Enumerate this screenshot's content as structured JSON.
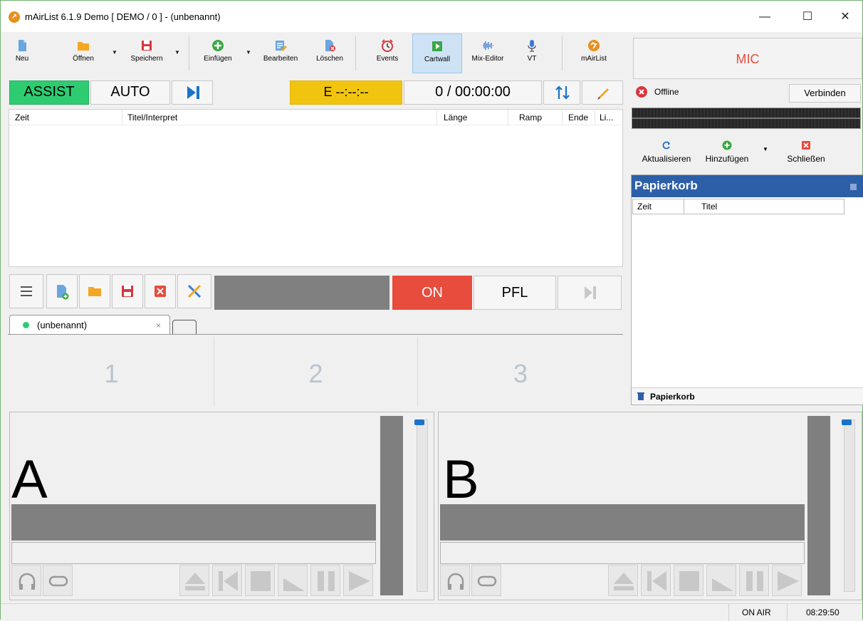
{
  "window": {
    "title": "mAirList 6.1.9 Demo [ DEMO / 0 ] - (unbenannt)",
    "app_icon": "mairlist-logo-icon"
  },
  "toolbar": {
    "neu": "Neu",
    "oeffnen": "Öffnen",
    "speichern": "Speichern",
    "einfuegen": "Einfügen",
    "bearbeiten": "Bearbeiten",
    "loeschen": "Löschen",
    "events": "Events",
    "cartwall": "Cartwall",
    "mix_editor": "Mix-Editor",
    "vt": "VT",
    "mairlist": "mAirList"
  },
  "mode": {
    "assist": "ASSIST",
    "auto": "AUTO",
    "end_time": "E  --:--:--",
    "counter": "0 / 00:00:00"
  },
  "playlist": {
    "columns": [
      "Zeit",
      "Titel/Interpret",
      "Länge",
      "Ramp",
      "Ende",
      "Li..."
    ]
  },
  "controls": {
    "on": "ON",
    "pfl": "PFL"
  },
  "cartwall": {
    "tab_label": "(unbenannt)",
    "tab_close": "×",
    "cells": [
      "1",
      "2",
      "3"
    ]
  },
  "players": {
    "a": "A",
    "b": "B"
  },
  "encoder": {
    "mic": "MIC",
    "status": "Offline",
    "connect": "Verbinden",
    "refresh": "Aktualisieren",
    "add": "Hinzufügen",
    "close": "Schließen"
  },
  "papierkorb": {
    "title": "Papierkorb",
    "columns": [
      "Zeit",
      "Titel"
    ],
    "footer": "Papierkorb"
  },
  "status": {
    "on_air": "ON AIR",
    "clock": "08:29:50"
  },
  "colors": {
    "assist_green": "#2ecc71",
    "end_yellow": "#f1c40f",
    "on_red": "#e74c3c",
    "mic_red": "#e74c3c",
    "panel_blue": "#2c5fa8",
    "accent_blue": "#1a73c9"
  }
}
